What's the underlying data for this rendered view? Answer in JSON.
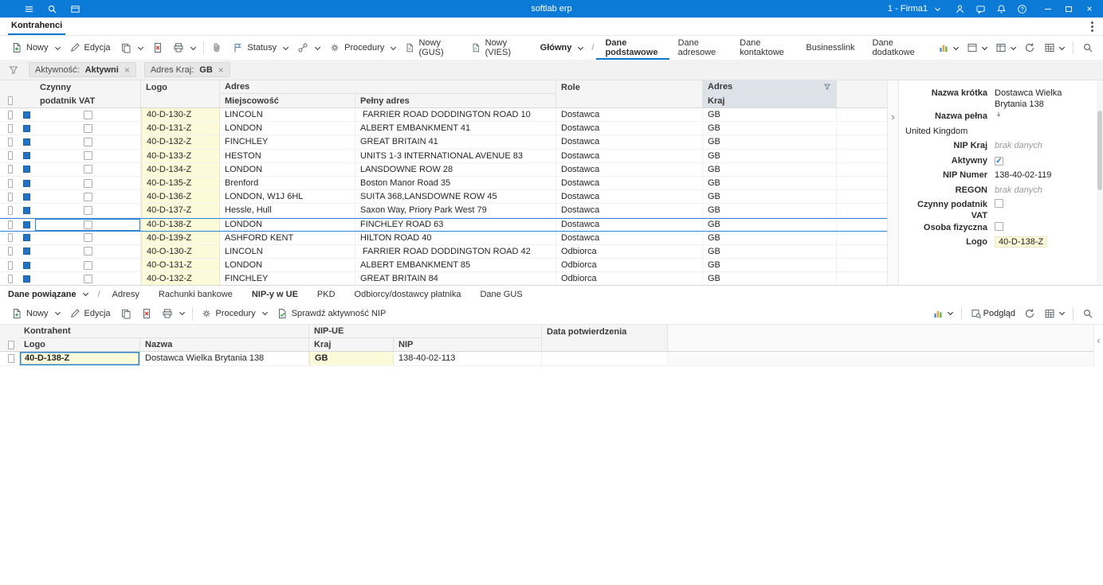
{
  "colors": {
    "titlebar_blue": "#0b7bd7",
    "accent_blue": "#0e78d1",
    "selection_border": "#2f86d2",
    "highlight_cell_yellow": "#fbfbda",
    "filtered_header": "#dde2e8"
  },
  "titlebar": {
    "title": "softlab erp",
    "company_selector": "1 - Firma1"
  },
  "doc_tabs": {
    "active": "Kontrahenci"
  },
  "main_toolbar": {
    "nowy": "Nowy",
    "edycja": "Edycja",
    "statusy": "Statusy",
    "procedury": "Procedury",
    "nowy_gus": "Nowy (GUS)",
    "nowy_vies": "Nowy (VIES)",
    "view_selector": "Główny",
    "view_tabs": [
      {
        "label": "Dane podstawowe",
        "active": true
      },
      {
        "label": "Dane adresowe",
        "active": false
      },
      {
        "label": "Dane kontaktowe",
        "active": false
      },
      {
        "label": "Businesslink",
        "active": false
      },
      {
        "label": "Dane dodatkowe",
        "active": false
      }
    ]
  },
  "filter_bar": {
    "chips": [
      {
        "field": "Aktywność:",
        "value": "Aktywni"
      },
      {
        "field": "Adres Kraj:",
        "value": "GB"
      }
    ]
  },
  "main_grid": {
    "headers": {
      "czynny_line1": "Czynny",
      "czynny_line2": "podatnik VAT",
      "logo": "Logo",
      "adres_group": "Adres",
      "miejscowosc": "Miejscowość",
      "pelny_adres": "Pełny adres",
      "role": "Role",
      "adres_kraj_group": "Adres",
      "kraj": "Kraj"
    },
    "rows": [
      {
        "logo": "40-D-130-Z",
        "city": "LINCOLN",
        "address": " FARRIER ROAD DODDINGTON ROAD 10",
        "role": "Dostawca",
        "country": "GB",
        "selected": false
      },
      {
        "logo": "40-D-131-Z",
        "city": "LONDON",
        "address": "ALBERT EMBANKMENT 41",
        "role": "Dostawca",
        "country": "GB",
        "selected": false
      },
      {
        "logo": "40-D-132-Z",
        "city": "FINCHLEY",
        "address": "GREAT BRITAIN 41",
        "role": "Dostawca",
        "country": "GB",
        "selected": false
      },
      {
        "logo": "40-D-133-Z",
        "city": "HESTON",
        "address": "UNITS 1-3 INTERNATIONAL AVENUE 83",
        "role": "Dostawca",
        "country": "GB",
        "selected": false
      },
      {
        "logo": "40-D-134-Z",
        "city": "LONDON",
        "address": "LANSDOWNE ROW 28",
        "role": "Dostawca",
        "country": "GB",
        "selected": false
      },
      {
        "logo": "40-D-135-Z",
        "city": "Brenford",
        "address": "Boston Manor Road 35",
        "role": "Dostawca",
        "country": "GB",
        "selected": false
      },
      {
        "logo": "40-D-136-Z",
        "city": "LONDON, W1J 6HL",
        "address": "SUITA 368,LANSDOWNE ROW 45",
        "role": "Dostawca",
        "country": "GB",
        "selected": false
      },
      {
        "logo": "40-D-137-Z",
        "city": "Hessle, Hull",
        "address": "Saxon Way, Priory Park West 79",
        "role": "Dostawca",
        "country": "GB",
        "selected": false
      },
      {
        "logo": "40-D-138-Z",
        "city": "LONDON",
        "address": "FINCHLEY ROAD 63",
        "role": "Dostawca",
        "country": "GB",
        "selected": true
      },
      {
        "logo": "40-D-139-Z",
        "city": "ASHFORD KENT",
        "address": "HILTON ROAD 40",
        "role": "Dostawca",
        "country": "GB",
        "selected": false
      },
      {
        "logo": "40-O-130-Z",
        "city": "LINCOLN",
        "address": " FARRIER ROAD DODDINGTON ROAD 42",
        "role": "Odbiorca",
        "country": "GB",
        "selected": false
      },
      {
        "logo": "40-O-131-Z",
        "city": "LONDON",
        "address": "ALBERT EMBANKMENT 85",
        "role": "Odbiorca",
        "country": "GB",
        "selected": false
      },
      {
        "logo": "40-O-132-Z",
        "city": "FINCHLEY",
        "address": "GREAT BRITAIN 84",
        "role": "Odbiorca",
        "country": "GB",
        "selected": false
      }
    ]
  },
  "details": {
    "fields": [
      {
        "type": "text",
        "label": "Nazwa krótka",
        "value": "Dostawca Wielka Brytania 138"
      },
      {
        "type": "expand",
        "label": "Nazwa pełna",
        "value": ""
      },
      {
        "type": "fullline",
        "label": "",
        "value": "United Kingdom"
      },
      {
        "type": "empty",
        "label": "NIP Kraj",
        "value": "brak danych"
      },
      {
        "type": "checkbox",
        "label": "Aktywny",
        "checked": true
      },
      {
        "type": "text",
        "label": "NIP Numer",
        "value": "138-40-02-119"
      },
      {
        "type": "empty",
        "label": "REGON",
        "value": "brak danych"
      },
      {
        "type": "checkbox",
        "label": "Czynny podatnik VAT",
        "checked": false
      },
      {
        "type": "checkbox",
        "label": "Osoba fizyczna",
        "checked": false
      },
      {
        "type": "logo",
        "label": "Logo",
        "value": "40-D-138-Z"
      }
    ]
  },
  "related": {
    "selector": "Dane powiązane",
    "tabs": [
      {
        "label": "Adresy",
        "active": false
      },
      {
        "label": "Rachunki bankowe",
        "active": false
      },
      {
        "label": "NIP-y w UE",
        "active": true
      },
      {
        "label": "PKD",
        "active": false
      },
      {
        "label": "Odbiorcy/dostawcy płatnika",
        "active": false
      },
      {
        "label": "Dane GUS",
        "active": false
      }
    ],
    "toolbar": {
      "nowy": "Nowy",
      "edycja": "Edycja",
      "procedury": "Procedury",
      "sprawdz": "Sprawdź aktywność NIP",
      "podglad": "Podgląd"
    },
    "grid": {
      "group_kontrahent": "Kontrahent",
      "group_nipue": "NIP-UE",
      "col_logo": "Logo",
      "col_nazwa": "Nazwa",
      "col_kraj": "Kraj",
      "col_nip": "NIP",
      "col_data": "Data potwierdzenia",
      "rows": [
        {
          "logo": "40-D-138-Z",
          "nazwa": "Dostawca Wielka Brytania 138",
          "kraj": "GB",
          "nip": "138-40-02-113",
          "data": ""
        }
      ]
    }
  }
}
